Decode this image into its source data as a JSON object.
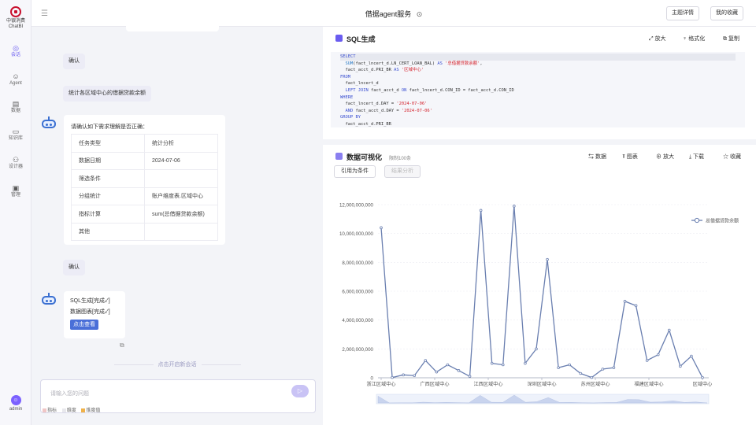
{
  "rail": {
    "logo_line1": "中银消费",
    "logo_line2": "ChatBI",
    "items": [
      {
        "label": "会话",
        "icon": "chat-icon"
      },
      {
        "label": "Agent",
        "icon": "agent-icon"
      },
      {
        "label": "数据",
        "icon": "database-icon"
      },
      {
        "label": "知识库",
        "icon": "book-icon"
      },
      {
        "label": "设计器",
        "icon": "designer-icon"
      },
      {
        "label": "管理",
        "icon": "admin-icon"
      }
    ],
    "user": "admin"
  },
  "topbar": {
    "title": "借据agent服务",
    "btn_detail": "主题详情",
    "btn_fav": "我的收藏"
  },
  "chat": {
    "confirm1": "确认",
    "question": "统计各区域中心的借据贷款余额",
    "assistant_prompt": "请确认如下需求理解是否正确：",
    "table": [
      [
        "任务类型",
        "统计分析"
      ],
      [
        "数据日期",
        "2024-07-06"
      ],
      [
        "筛选条件",
        ""
      ],
      [
        "分组统计",
        "账户维度表.区域中心"
      ],
      [
        "指标计算",
        "sum(总借据贷款余额)"
      ],
      [
        "其他",
        ""
      ]
    ],
    "confirm2": "确认",
    "status1": "SQL生成[完成✓]",
    "status2": "数据图表[完成✓]",
    "view_btn": "点击查看",
    "new_session": "点击开启新会话",
    "input_placeholder": "请输入您的问题",
    "legend": [
      "指标",
      "维度",
      "维度值"
    ]
  },
  "sql": {
    "title": "SQL生成",
    "tools": [
      "放大",
      "格式化",
      "复制"
    ],
    "lines": [
      "SELECT",
      "  SUM(fact_lncert_d.LN_CERT_LOAN_BAL) AS '总借据贷款余额',",
      "  fact_acct_d.PRI_BR AS '区域中心'",
      "FROM",
      "  fact_lncert_d",
      "  LEFT JOIN fact_acct_d ON fact_lncert_d.CON_ID = fact_acct_d.CON_ID",
      "WHERE",
      "  fact_lncert_d.DAY = '2024-07-06'",
      "  AND fact_acct_d.DAY = '2024-07-06'",
      "GROUP BY",
      "  fact_acct_d.PRI_BR"
    ]
  },
  "viz": {
    "title": "数据可视化",
    "limit": "限制100条",
    "tools": [
      "数据",
      "图表",
      "放大",
      "下载",
      "收藏"
    ],
    "btn_cite": "引用为条件",
    "btn_analyze": "结果分析"
  },
  "chart_data": {
    "type": "line",
    "series": [
      {
        "name": "总借据贷款余额",
        "values": [
          10400000000,
          20000000,
          200000000,
          150000000,
          1200000000,
          400000000,
          900000000,
          500000000,
          100000000,
          11600000000,
          1000000000,
          900000000,
          11900000000,
          1000000000,
          2000000000,
          8200000000,
          700000000,
          900000000,
          300000000,
          20000000,
          600000000,
          700000000,
          5300000000,
          5000000000,
          1200000000,
          1600000000,
          3300000000,
          800000000,
          1500000000,
          20000000
        ]
      }
    ],
    "x_tick_labels": [
      "浙江区域中心",
      "广西区域中心",
      "江西区域中心",
      "深圳区域中心",
      "苏州区域中心",
      "福建区域中心",
      "区域中心"
    ],
    "y_ticks": [
      "0",
      "2,000,000,000",
      "4,000,000,000",
      "6,000,000,000",
      "8,000,000,000",
      "10,000,000,000",
      "12,000,000,000"
    ],
    "ylim": [
      0,
      12000000000
    ],
    "legend_position": "top-right",
    "color": "#6a7fb0"
  }
}
